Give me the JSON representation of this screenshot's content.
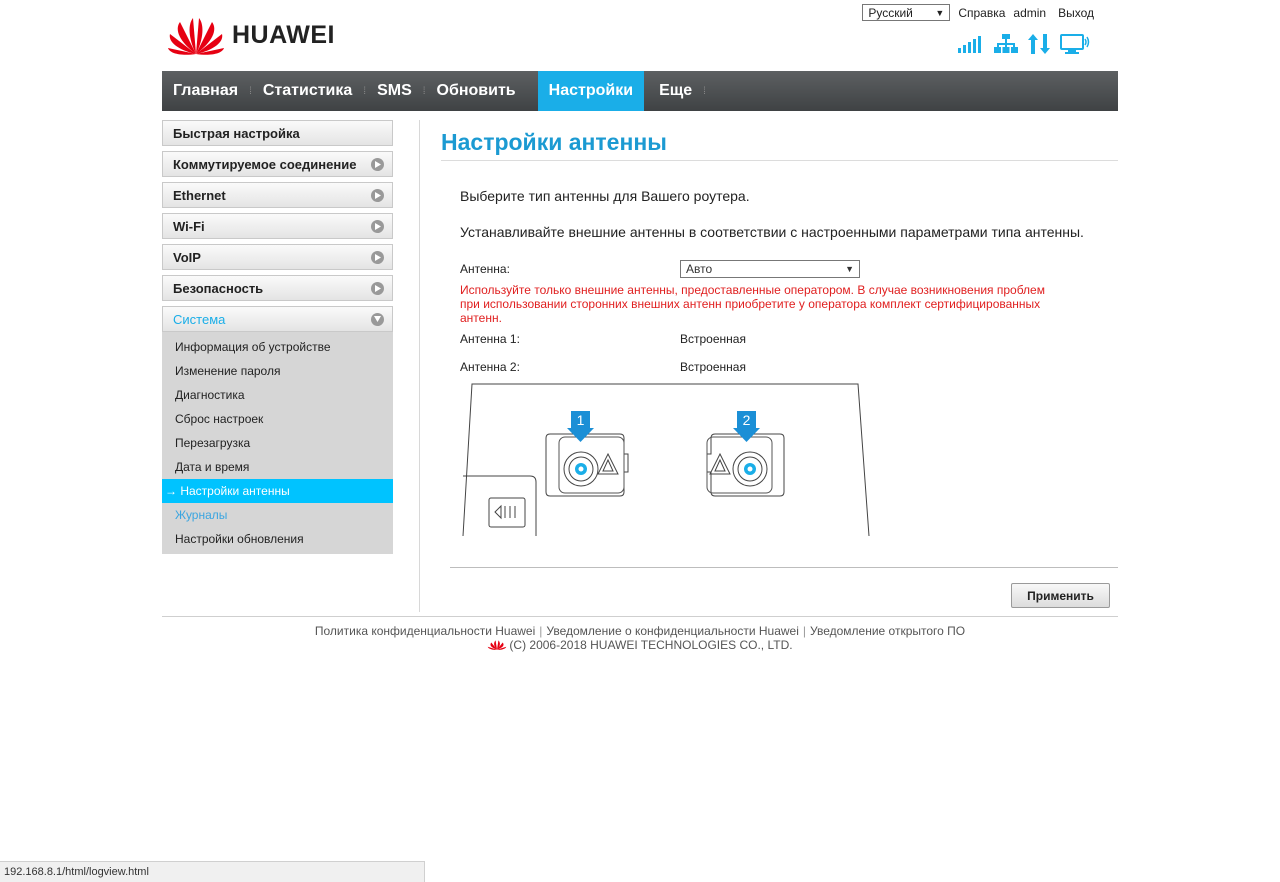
{
  "header": {
    "brand": "HUAWEI",
    "language": "Русский",
    "help": "Справка",
    "user": "admin",
    "logout": "Выход"
  },
  "nav": [
    "Главная",
    "Статистика",
    "SMS",
    "Обновить",
    "Настройки",
    "Еще"
  ],
  "sidebar": {
    "items": [
      {
        "label": "Быстрая настройка"
      },
      {
        "label": "Коммутируемое соединение"
      },
      {
        "label": "Ethernet"
      },
      {
        "label": "Wi-Fi"
      },
      {
        "label": "VoIP"
      },
      {
        "label": "Безопасность"
      },
      {
        "label": "Система"
      }
    ],
    "submenu": [
      "Информация об устройстве",
      "Изменение пароля",
      "Диагностика",
      "Сброс настроек",
      "Перезагрузка",
      "Дата и время",
      "→ Настройки антенны",
      "Журналы",
      "Настройки обновления"
    ]
  },
  "content": {
    "title": "Настройки антенны",
    "intro1": "Выберите тип антенны для Вашего роутера.",
    "intro2": "Устанавливайте внешние антенны в соответствии с настроенными параметрами типа антенны.",
    "antenna_label": "Антенна:",
    "antenna_value": "Авто",
    "warning": "Используйте только внешние антенны, предоставленные оператором. В случае возникновения проблем при использовании сторонних внешних антенн приобретите у оператора комплект сертифицированных антенн.",
    "antenna1_label": "Антенна 1:",
    "antenna1_value": "Встроенная",
    "antenna2_label": "Антенна 2:",
    "antenna2_value": "Встроенная",
    "port1_num": "1",
    "port2_num": "2",
    "apply": "Применить"
  },
  "footer": {
    "link1": "Политика конфиденциальности Huawei",
    "link2": "Уведомление о конфиденциальности Huawei",
    "link3": "Уведомление открытого ПО",
    "copyright": "(C) 2006-2018 HUAWEI TECHNOLOGIES CO., LTD."
  },
  "statusbar": "192.168.8.1/html/logview.html",
  "colors": {
    "accent": "#1aaee8",
    "nav_bg": "#4a4d4f",
    "warning": "#e02020",
    "brand_red": "#e60012"
  }
}
